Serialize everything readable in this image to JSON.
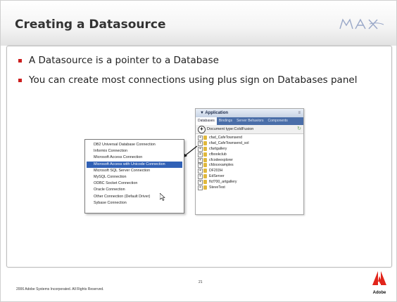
{
  "slide": {
    "title": "Creating a Datasource",
    "logo_text": "MAX",
    "bullets": [
      "A Datasource is a pointer to a Database",
      "You can create most connections using plus sign on Databases panel"
    ],
    "footer": {
      "copyright": "2006 Adobe Systems Incorporated.  All Rights Reserved.",
      "page_number": "21",
      "brand": "Adobe"
    }
  },
  "screenshot": {
    "panel": {
      "title": "▼ Application",
      "tabs": [
        "Databases",
        "Bindings",
        "Server Behaviors",
        "Components"
      ],
      "document_type": "Document type:ColdFusion",
      "databases": [
        "cfad_CafeTownsend",
        "cfad_CafeTownsend_sol",
        "cfartgallery",
        "cfbookclub",
        "cfcodeexplorer",
        "cfdocexamples",
        "DF203H",
        "EdServer",
        "flcf700_artgallery",
        "SteveTest"
      ]
    },
    "menu": {
      "items": [
        "DB2 Universal Database Connection",
        "Informix Connection",
        "Microsoft Access Connection",
        "Microsoft Access with Unicode Connection",
        "Microsoft SQL Server Connection",
        "MySQL Connection",
        "ODBC Socket Connection",
        "Oracle Connection",
        "Other Connection (Default Driver)",
        "Sybase Connection"
      ],
      "selected_index": 3
    }
  },
  "colors": {
    "bullet": "#cc1e1e",
    "selection": "#3161b6",
    "adobe_red": "#e1251b"
  }
}
